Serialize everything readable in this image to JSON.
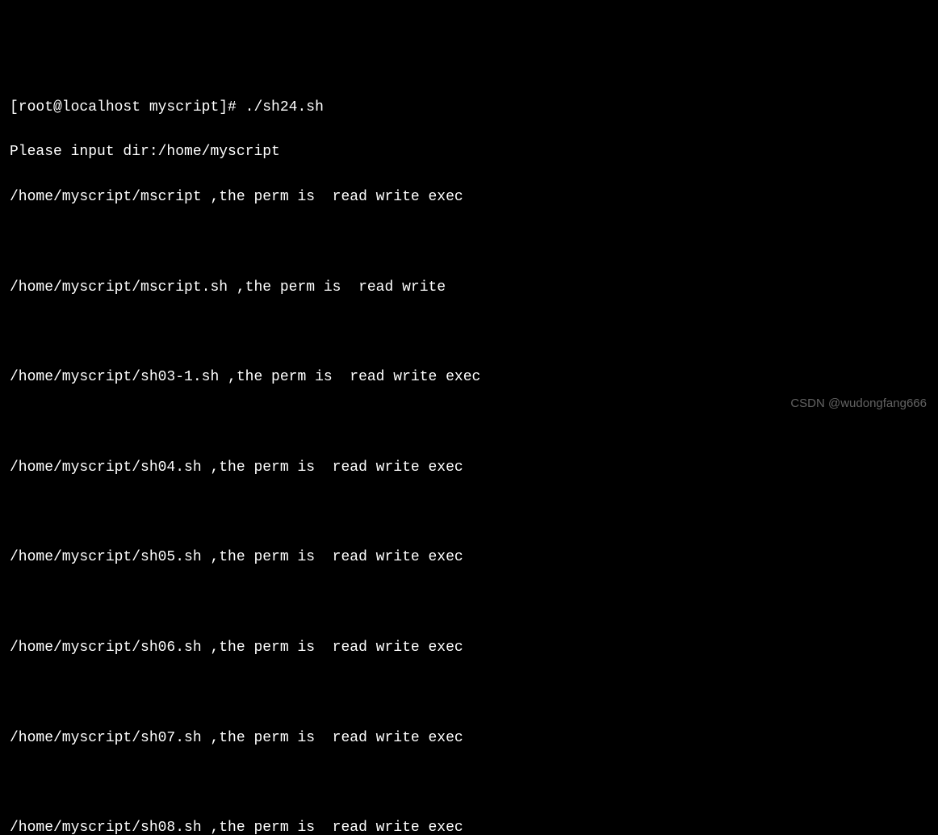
{
  "terminal": {
    "prompt": "[root@localhost myscript]# ",
    "command": "./sh24.sh",
    "input_line": "Please input dir:/home/myscript",
    "entries": [
      {
        "path": "/home/myscript/mscript",
        "sep": " ,the perm is  ",
        "perm": "read write exec"
      },
      {
        "path": "/home/myscript/mscript.sh",
        "sep": " ,the perm is  ",
        "perm": "read write"
      },
      {
        "path": "/home/myscript/sh03-1.sh",
        "sep": " ,the perm is  ",
        "perm": "read write exec"
      },
      {
        "path": "/home/myscript/sh04.sh",
        "sep": " ,the perm is  ",
        "perm": "read write exec"
      },
      {
        "path": "/home/myscript/sh05.sh",
        "sep": " ,the perm is  ",
        "perm": "read write exec"
      },
      {
        "path": "/home/myscript/sh06.sh",
        "sep": " ,the perm is  ",
        "perm": "read write exec"
      },
      {
        "path": "/home/myscript/sh07.sh",
        "sep": " ,the perm is  ",
        "perm": "read write exec"
      },
      {
        "path": "/home/myscript/sh08.sh",
        "sep": " ,the perm is  ",
        "perm": "read write exec"
      }
    ]
  },
  "watermark": "CSDN @wudongfang666"
}
